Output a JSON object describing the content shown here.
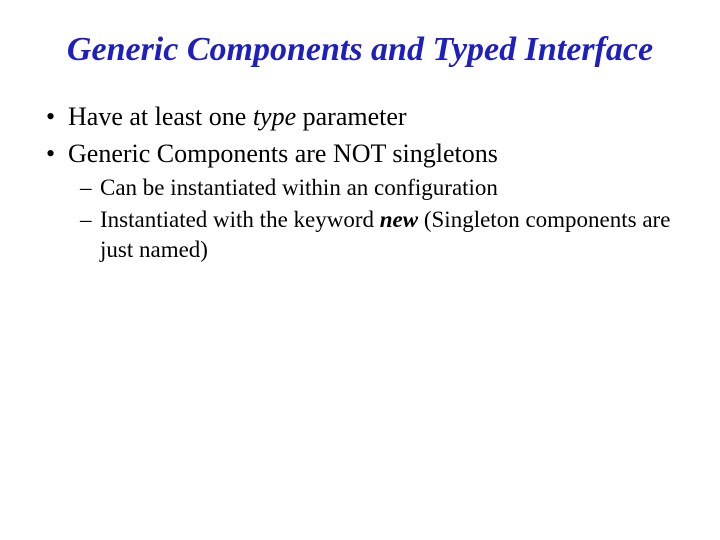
{
  "title": "Generic Components and Typed Interface",
  "bullets": {
    "b1_pre": "Have at least one ",
    "b1_em": "type",
    "b1_post": " parameter",
    "b2": "Generic Components are NOT singletons",
    "b2a": "Can be instantiated within an configuration",
    "b2b_pre": "Instantiated with the keyword ",
    "b2b_em": "new",
    "b2b_post": " (Singleton components are just named)"
  }
}
